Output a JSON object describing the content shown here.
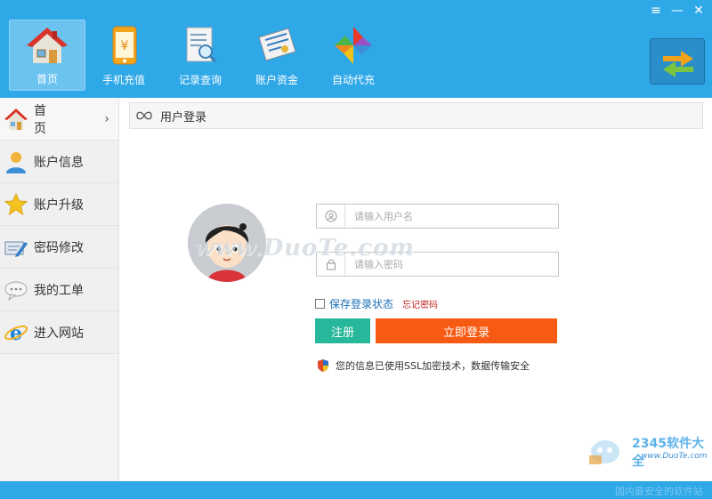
{
  "window_controls": {
    "menu": "≡",
    "minimize": "—",
    "close": "✕"
  },
  "nav": [
    {
      "label": "首页",
      "icon": "home-icon",
      "active": true
    },
    {
      "label": "手机充值",
      "icon": "mobile-phone-icon"
    },
    {
      "label": "记录查询",
      "icon": "search-record-icon"
    },
    {
      "label": "账户资金",
      "icon": "account-funds-icon"
    },
    {
      "label": "自动代充",
      "icon": "pinwheel-icon"
    }
  ],
  "sidebar": {
    "home": {
      "label": "首 页",
      "arrow": "›"
    },
    "items": [
      {
        "label": "账户信息",
        "icon": "user-icon"
      },
      {
        "label": "账户升级",
        "icon": "star-icon"
      },
      {
        "label": "密码修改",
        "icon": "password-edit-icon"
      },
      {
        "label": "我的工单",
        "icon": "chat-bubble-icon"
      },
      {
        "label": "进入网站",
        "icon": "ie-browser-icon"
      }
    ]
  },
  "content": {
    "title": "用户登录"
  },
  "login": {
    "username_placeholder": "请输入用户名",
    "password_placeholder": "请输入密码",
    "remember_label": "保存登录状态",
    "forgot_label": "忘记密码",
    "register_label": "注册",
    "login_label": "立即登录",
    "secure_text": "您的信息已使用SSL加密技术，数据传输安全"
  },
  "watermarks": {
    "main": "www.DuoTe.com",
    "brand": "2345软件大全",
    "brand_url": "www.DuoTe.com",
    "footer": "国内最安全的软件站"
  },
  "colors": {
    "primary": "#2fa8e8",
    "login_button": "#f65a13",
    "register_button": "#27b79a",
    "link": "#1e6fb8",
    "forgot": "#c0221d"
  }
}
